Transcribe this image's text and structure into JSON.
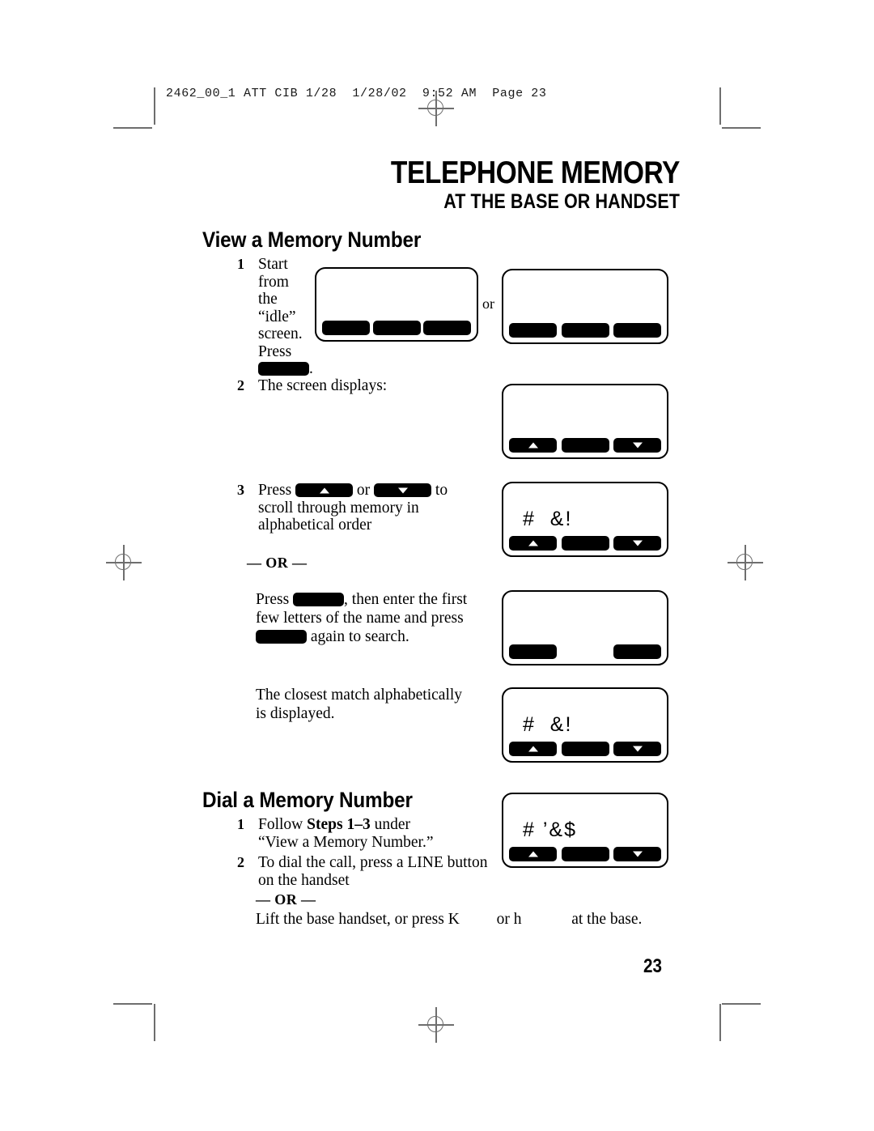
{
  "print_slug": "2462_00_1 ATT CIB 1/28  1/28/02  9:52 AM  Page 23",
  "headings": {
    "title_main": "TELEPHONE MEMORY",
    "title_sub": "AT THE BASE OR HANDSET",
    "section_view": "View a Memory Number",
    "section_dial": "Dial a Memory Number"
  },
  "or_divider": "— OR —",
  "or_inline": "or",
  "page_number": "23",
  "view_steps": {
    "step1": {
      "num": "1",
      "line1": "Start",
      "line2": "from",
      "line3": "the",
      "line4": "“idle”",
      "line5": "screen.",
      "line6": "Press",
      "trailing": "."
    },
    "step2": {
      "num": "2",
      "text": "The screen displays:"
    },
    "step3": {
      "num": "3",
      "lead": "Press",
      "mid": "or",
      "tail": "to",
      "line2": "scroll through memory in",
      "line3": "alphabetical order"
    },
    "alt": {
      "lead": "Press",
      "mid": ", then enter the first",
      "line2": "few letters of the name and press",
      "tail": "again to search."
    },
    "result": {
      "line1": "The closest match alphabetically",
      "line2": "is displayed."
    }
  },
  "dial_steps": {
    "step1": {
      "num": "1",
      "pre": "Follow ",
      "strong": "Steps 1–3",
      "post": " under",
      "line2": "“View a Memory Number.”"
    },
    "step2": {
      "num": "2",
      "line1": "To dial the call, press a LINE button",
      "line2": "on the handset"
    },
    "alt": {
      "part1": "Lift the base handset, or press",
      "glyph1": "K",
      "part2": "or",
      "glyph2": "h",
      "part3": "at the base."
    }
  },
  "lcds": {
    "idle_base": {
      "text": "",
      "keys": [
        "solid",
        "solid",
        "solid"
      ]
    },
    "idle_handset": {
      "text": "",
      "keys": [
        "solid",
        "solid",
        "solid"
      ]
    },
    "menu": {
      "text": "",
      "keys": [
        "up",
        "solid",
        "down"
      ]
    },
    "scroll": {
      "text": "#  &!",
      "keys": [
        "up",
        "solid",
        "down"
      ]
    },
    "search": {
      "text": "",
      "keys": [
        "solid",
        "blank",
        "solid"
      ]
    },
    "match": {
      "text": "#  &!",
      "keys": [
        "up",
        "solid",
        "down"
      ]
    },
    "dial": {
      "text": "# ’&$",
      "keys": [
        "up",
        "solid",
        "down"
      ]
    }
  }
}
